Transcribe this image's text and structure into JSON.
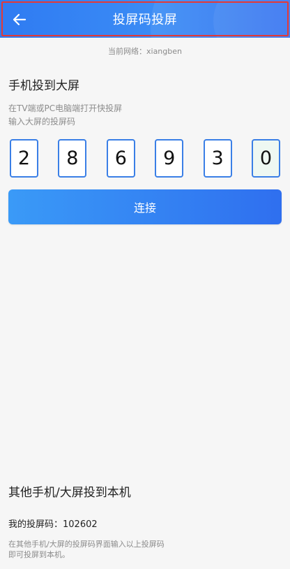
{
  "header": {
    "title": "投屏码投屏",
    "back_icon": "arrow-left-icon"
  },
  "network": {
    "text": "当前网络：xiangben"
  },
  "cast_to_screen": {
    "title": "手机投到大屏",
    "hint_line1": "在TV端或PC电脑端打开快投屏",
    "hint_line2": "输入大屏的投屏码",
    "code_digits": [
      "2",
      "8",
      "6",
      "9",
      "3",
      "0"
    ],
    "connect_label": "连接"
  },
  "receive": {
    "title": "其他手机/大屏投到本机",
    "my_code_label": "我的投屏码：102602",
    "hint_line1": "在其他手机/大屏的投屏码界面输入以上投屏码",
    "hint_line2": "即可投屏到本机。"
  },
  "colors": {
    "header": "#3b8cf5",
    "accent": "#2f6fef",
    "highlight": "#e53935"
  }
}
